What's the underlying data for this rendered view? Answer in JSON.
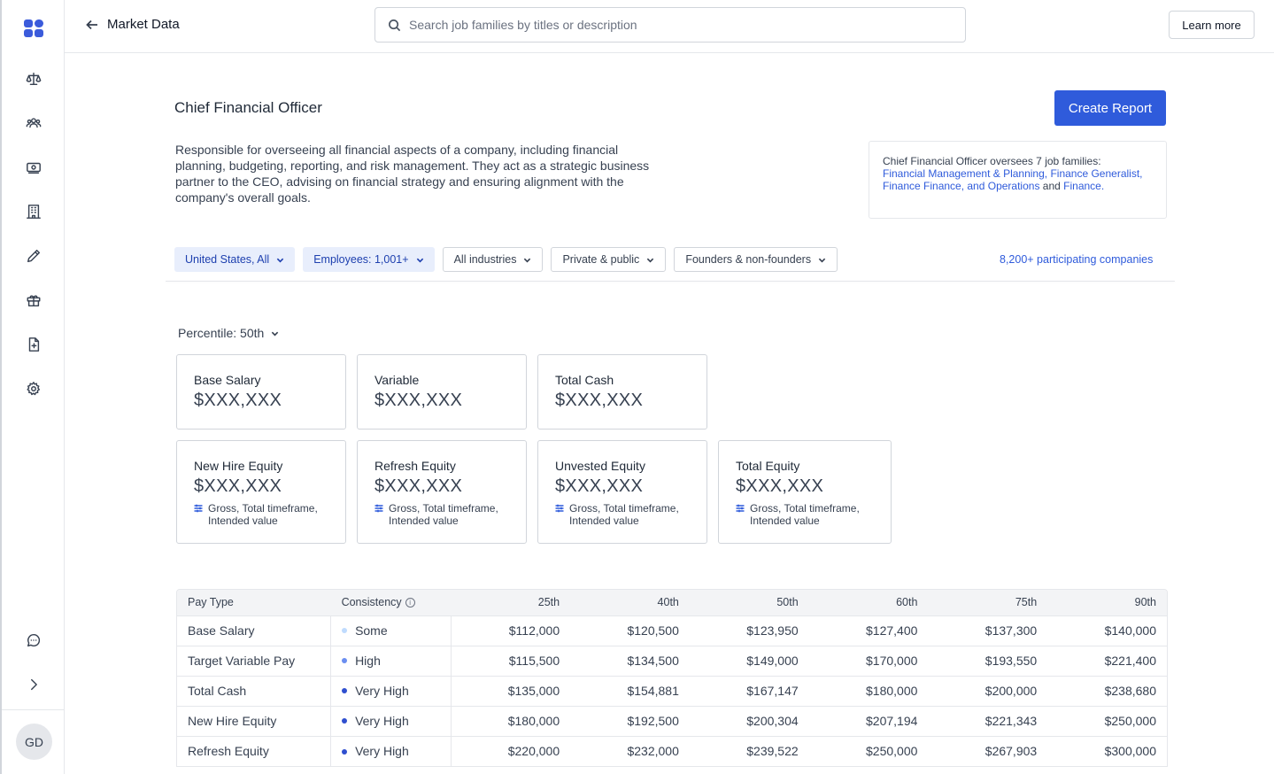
{
  "nav": {
    "icons": [
      "scale-icon",
      "team-icon",
      "money-icon",
      "building-icon",
      "pencil-icon",
      "gift-icon",
      "document-icon",
      "gear-icon",
      "chat-icon",
      "chevron-right-icon"
    ],
    "avatar": "GD"
  },
  "topbar": {
    "back_label": "Market Data",
    "search_placeholder": "Search job families by titles or description",
    "learn_more": "Learn more"
  },
  "header": {
    "title": "Chief Financial Officer",
    "create_report": "Create Report",
    "description": "Responsible for overseeing all financial aspects of a company, including financial planning, budgeting, reporting, and risk management. They act as a strategic business partner to the CEO, advising on financial strategy and ensuring alignment with the company's overall goals.",
    "info_prefix": "Chief Financial Officer oversees 7 job families:",
    "info_links": "Financial Management & Planning, Finance Generalist, Finance Finance, and Operations",
    "info_and": " and ",
    "info_last": "Finance."
  },
  "filters": {
    "items": [
      {
        "label": "United States, All",
        "active": true
      },
      {
        "label": "Employees: 1,001+",
        "active": true
      },
      {
        "label": "All industries",
        "active": false
      },
      {
        "label": "Private & public",
        "active": false
      },
      {
        "label": "Founders & non-founders",
        "active": false
      }
    ],
    "participating": "8,200+ participating companies"
  },
  "percentile": {
    "label": "Percentile: 50th"
  },
  "cards": {
    "row1": [
      {
        "label": "Base Salary",
        "value": "$XXX,XXX"
      },
      {
        "label": "Variable",
        "value": "$XXX,XXX"
      },
      {
        "label": "Total Cash",
        "value": "$XXX,XXX"
      }
    ],
    "row2": [
      {
        "label": "New Hire Equity",
        "value": "$XXX,XXX",
        "note": "Gross, Total timeframe, Intended value"
      },
      {
        "label": "Refresh Equity",
        "value": "$XXX,XXX",
        "note": "Gross, Total timeframe, Intended value"
      },
      {
        "label": "Unvested Equity",
        "value": "$XXX,XXX",
        "note": "Gross, Total timeframe, Intended value"
      },
      {
        "label": "Total Equity",
        "value": "$XXX,XXX",
        "note": "Gross, Total timeframe, Intended value"
      }
    ]
  },
  "table": {
    "headers": [
      "Pay Type",
      "Consistency",
      "25th",
      "40th",
      "50th",
      "60th",
      "75th",
      "90th"
    ],
    "rows": [
      {
        "type": "Base Salary",
        "consistency": "Some",
        "dot": "#bfdbfe",
        "values": [
          "$112,000",
          "$120,500",
          "$123,950",
          "$127,400",
          "$137,300",
          "$140,000"
        ]
      },
      {
        "type": "Target Variable Pay",
        "consistency": "High",
        "dot": "#6b8ef0",
        "values": [
          "$115,500",
          "$134,500",
          "$149,000",
          "$170,000",
          "$193,550",
          "$221,400"
        ]
      },
      {
        "type": "Total Cash",
        "consistency": "Very High",
        "dot": "#2f4fcf",
        "values": [
          "$135,000",
          "$154,881",
          "$167,147",
          "$180,000",
          "$200,000",
          "$238,680"
        ]
      },
      {
        "type": "New Hire Equity",
        "consistency": "Very High",
        "dot": "#2f4fcf",
        "values": [
          "$180,000",
          "$192,500",
          "$200,304",
          "$207,194",
          "$221,343",
          "$250,000"
        ]
      },
      {
        "type": "Refresh Equity",
        "consistency": "Very High",
        "dot": "#2f4fcf",
        "values": [
          "$220,000",
          "$232,000",
          "$239,522",
          "$250,000",
          "$267,903",
          "$300,000"
        ]
      }
    ]
  }
}
